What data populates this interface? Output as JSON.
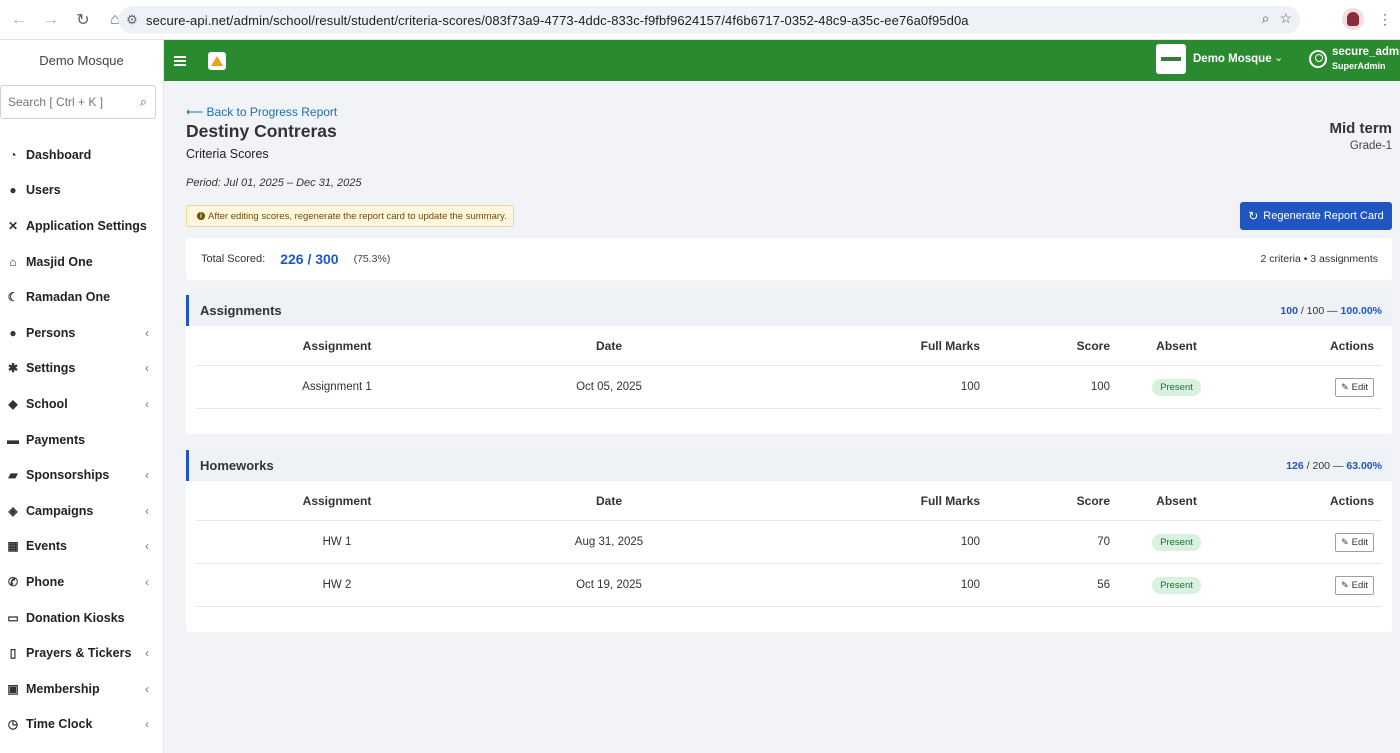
{
  "browser": {
    "url": "secure-api.net/admin/school/result/student/criteria-scores/083f73a9-4773-4ddc-833c-f9fbf9624157/4f6b6717-0352-48c9-a35c-ee76a0f95d0a"
  },
  "sidebar": {
    "brand": "Demo Mosque",
    "search_placeholder": "Search [ Ctrl + K ]",
    "items": [
      {
        "label": "Dashboard",
        "icon": "dashboard-icon",
        "chevron": false
      },
      {
        "label": "Users",
        "icon": "user-icon",
        "chevron": false
      },
      {
        "label": "Application Settings",
        "icon": "tools-icon",
        "chevron": false
      },
      {
        "label": "Masjid One",
        "icon": "mosque-icon",
        "chevron": false
      },
      {
        "label": "Ramadan One",
        "icon": "moon-icon",
        "chevron": false
      },
      {
        "label": "Persons",
        "icon": "people-icon",
        "chevron": true
      },
      {
        "label": "Settings",
        "icon": "gear-icon",
        "chevron": true
      },
      {
        "label": "School",
        "icon": "graduation-cap-icon",
        "chevron": true
      },
      {
        "label": "Payments",
        "icon": "money-icon",
        "chevron": false
      },
      {
        "label": "Sponsorships",
        "icon": "ticket-icon",
        "chevron": true
      },
      {
        "label": "Campaigns",
        "icon": "handshake-icon",
        "chevron": true
      },
      {
        "label": "Events",
        "icon": "calendar-icon",
        "chevron": true
      },
      {
        "label": "Phone",
        "icon": "phone-icon",
        "chevron": true
      },
      {
        "label": "Donation Kiosks",
        "icon": "monitor-icon",
        "chevron": false
      },
      {
        "label": "Prayers & Tickers",
        "icon": "mobile-icon",
        "chevron": true
      },
      {
        "label": "Membership",
        "icon": "lock-icon",
        "chevron": true
      },
      {
        "label": "Time Clock",
        "icon": "clock-icon",
        "chevron": true
      }
    ]
  },
  "topbar": {
    "org_name": "Demo Mosque",
    "user_name": "secure_admin",
    "user_role": "SuperAdmin"
  },
  "page": {
    "back_link": "⟵ Back to Progress Report",
    "student_name": "Destiny Contreras",
    "subtitle": "Criteria Scores",
    "term": "Mid term",
    "grade": "Grade-1",
    "period": "Period: Jul 01, 2025 – Dec 31, 2025",
    "alert": "After editing scores, regenerate the report card to update the summary.",
    "regen_button": "Regenerate Report Card"
  },
  "total": {
    "label": "Total Scored:",
    "value": "226 / 300",
    "percent": "(75.3%)",
    "meta": "2 criteria • 3 assignments"
  },
  "columns": [
    "Assignment",
    "Date",
    "Full Marks",
    "Score",
    "Absent",
    "Actions"
  ],
  "sections": [
    {
      "title": "Assignments",
      "scored": "100",
      "full": "/ 100 —",
      "percent": "100.00%",
      "rows": [
        {
          "name": "Assignment 1",
          "date": "Oct 05, 2025",
          "full": "100",
          "score": "100",
          "absent": "Present",
          "action": "Edit"
        }
      ]
    },
    {
      "title": "Homeworks",
      "scored": "126",
      "full": "/ 200 —",
      "percent": "63.00%",
      "rows": [
        {
          "name": "HW 1",
          "date": "Aug 31, 2025",
          "full": "100",
          "score": "70",
          "absent": "Present",
          "action": "Edit"
        },
        {
          "name": "HW 2",
          "date": "Oct 19, 2025",
          "full": "100",
          "score": "56",
          "absent": "Present",
          "action": "Edit"
        }
      ]
    }
  ],
  "colors": {
    "topbar": "#2a8a2f",
    "accent": "#1f56c1",
    "present_badge": "#d9f2e0"
  }
}
